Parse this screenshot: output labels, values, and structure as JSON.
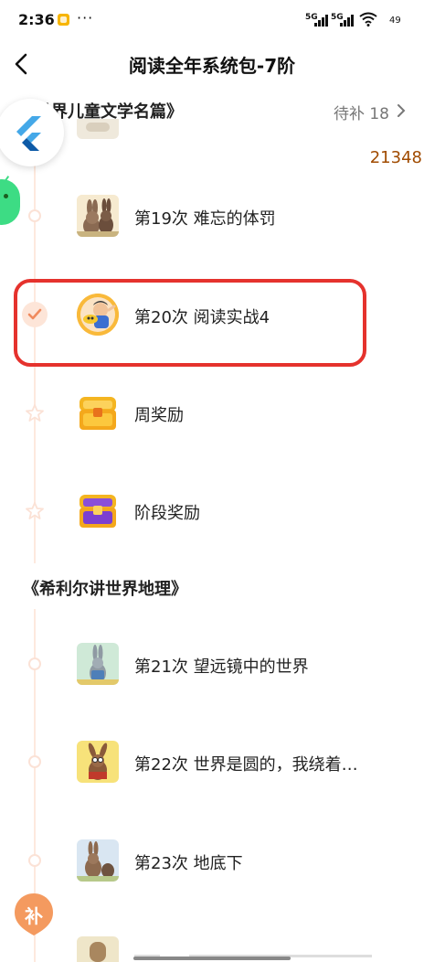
{
  "status_bar": {
    "time": "2:36",
    "more": "···",
    "net1": "5G",
    "net2": "5G",
    "battery": "49"
  },
  "header": {
    "title": "阅读全年系统包-7阶"
  },
  "section1": {
    "title_partial": "世界儿童文学名篇》",
    "pending": "待补 18"
  },
  "overlay": {
    "counter": "21348"
  },
  "items": [
    {
      "label": "第19次 难忘的体罚",
      "thumb": "rabbit-family-thumbnail"
    },
    {
      "label": "第20次 阅读实战4",
      "thumb": "teacher-avatar-thumbnail",
      "state": "completed"
    },
    {
      "label": "周奖励",
      "thumb": "gold-treasure-chest"
    },
    {
      "label": "阶段奖励",
      "thumb": "purple-treasure-chest"
    }
  ],
  "section2": {
    "title": "《希利尔讲世界地理》"
  },
  "items2": [
    {
      "label": "第21次 望远镜中的世界",
      "thumb": "rabbit-telescope-thumbnail"
    },
    {
      "label": "第22次 世界是圆的，我绕着…",
      "thumb": "rabbit-globe-thumbnail"
    },
    {
      "label": "第23次 地底下",
      "thumb": "rabbit-underground-thumbnail"
    }
  ],
  "bu_button": "补",
  "colors": {
    "accent": "#f08a5d",
    "highlight": "#e5322d",
    "timeline": "#fde9de"
  }
}
